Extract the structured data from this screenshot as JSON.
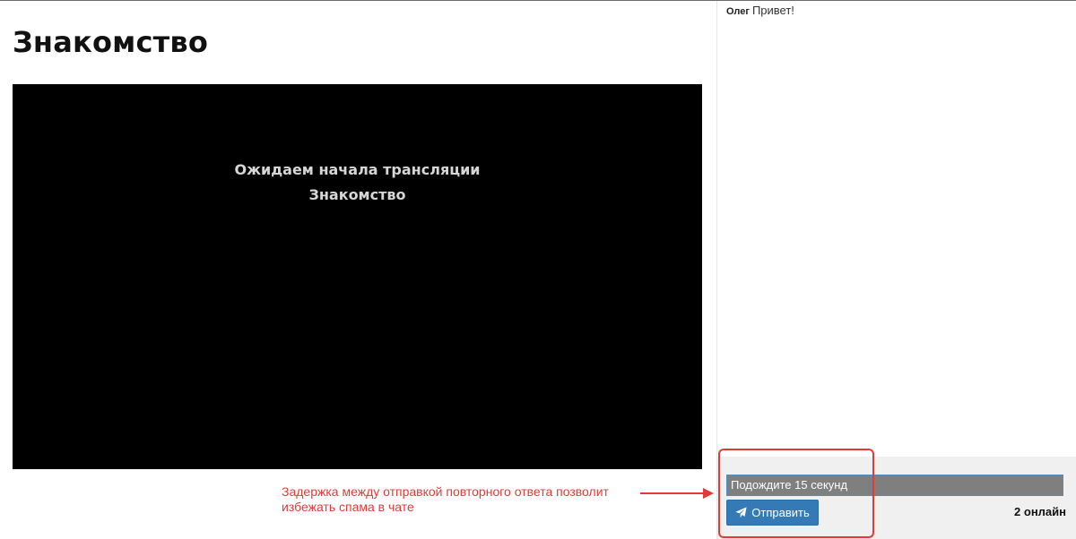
{
  "page": {
    "title": "Знакомство"
  },
  "video": {
    "waiting_line1": "Ожидаем начала трансляции",
    "waiting_line2": "Знакомство"
  },
  "chat": {
    "messages": [
      {
        "author": "Олег",
        "text": "Привет!"
      }
    ],
    "input_value": "Подождите 15 секунд",
    "send_label": "Отправить",
    "online_count": "2 онлайн"
  },
  "annotation": {
    "text_line1": "Задержка между отправкой повторного ответа позволит",
    "text_line2": "избежать спама в чате",
    "color": "#e53935"
  },
  "colors": {
    "send_button": "#337ab7",
    "video_bg": "#000000",
    "input_disabled_bg": "#7f7f7f"
  }
}
